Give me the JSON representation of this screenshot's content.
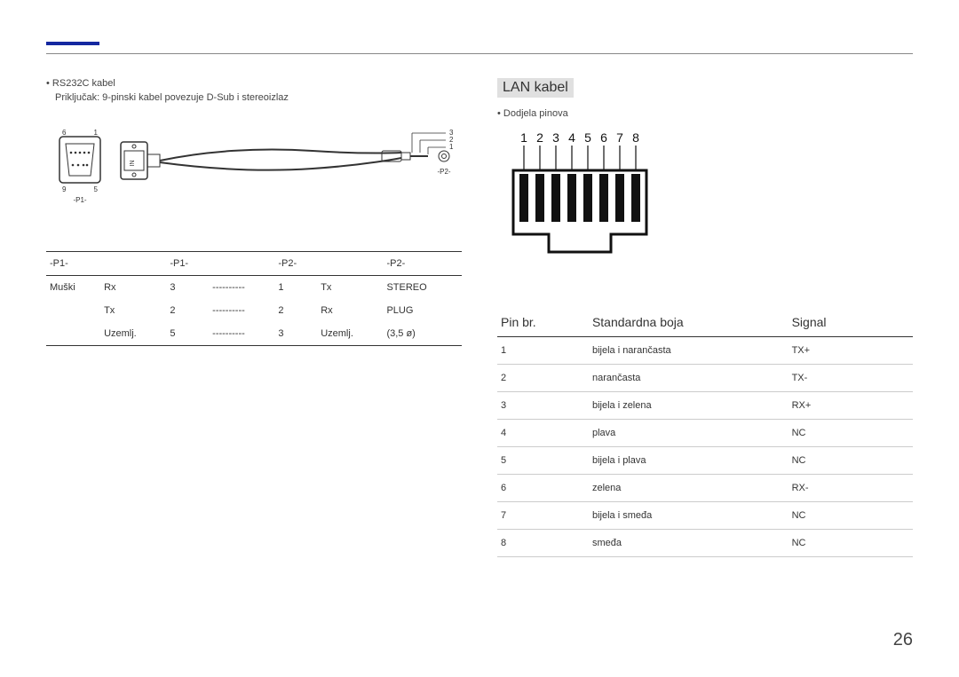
{
  "left": {
    "bullet": "RS232C kabel",
    "subline": "Priključak: 9-pinski kabel povezuje D-Sub i stereoizlaz",
    "diagram": {
      "p1_tl": "6",
      "p1_tr": "1",
      "p1_bl": "9",
      "p1_br": "5",
      "p1_label": "-P1-",
      "p2_label": "-P2-",
      "jack_1": "3",
      "jack_2": "2",
      "jack_3": "1"
    },
    "table_headers": [
      "-P1-",
      "-P1-",
      "",
      "",
      "-P2-",
      "",
      "-P2-"
    ],
    "rows": [
      [
        "Muški",
        "Rx",
        "3",
        "----------",
        "1",
        "Tx",
        "STEREO"
      ],
      [
        "",
        "Tx",
        "2",
        "----------",
        "2",
        "Rx",
        "PLUG"
      ],
      [
        "",
        "Uzemlj.",
        "5",
        "----------",
        "3",
        "Uzemlj.",
        "(3,5 ø)"
      ]
    ]
  },
  "right": {
    "title": "LAN kabel",
    "bullet": "Dodjela pinova",
    "pin_numbers": [
      "1",
      "2",
      "3",
      "4",
      "5",
      "6",
      "7",
      "8"
    ],
    "headers": {
      "pin": "Pin br.",
      "color": "Standardna boja",
      "signal": "Signal"
    },
    "rows": [
      {
        "pin": "1",
        "color": "bijela i narančasta",
        "signal": "TX+"
      },
      {
        "pin": "2",
        "color": "narančasta",
        "signal": "TX-"
      },
      {
        "pin": "3",
        "color": "bijela i zelena",
        "signal": "RX+"
      },
      {
        "pin": "4",
        "color": "plava",
        "signal": "NC"
      },
      {
        "pin": "5",
        "color": "bijela i plava",
        "signal": "NC"
      },
      {
        "pin": "6",
        "color": "zelena",
        "signal": "RX-"
      },
      {
        "pin": "7",
        "color": "bijela i smeđa",
        "signal": "NC"
      },
      {
        "pin": "8",
        "color": "smeđa",
        "signal": "NC"
      }
    ]
  },
  "page_number": "26"
}
